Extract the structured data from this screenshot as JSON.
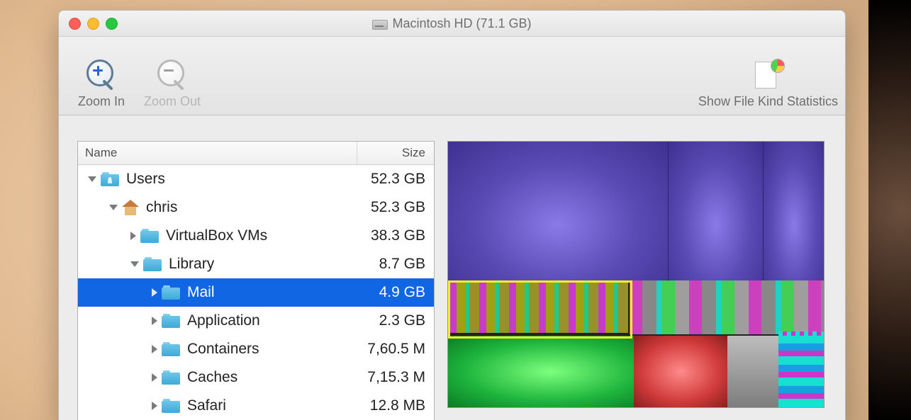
{
  "window": {
    "title": "Macintosh HD (71.1 GB)"
  },
  "toolbar": {
    "zoom_in": "Zoom In",
    "zoom_out": "Zoom Out",
    "stats": "Show File Kind Statistics"
  },
  "tree": {
    "header_name": "Name",
    "header_size": "Size",
    "rows": [
      {
        "indent": 0,
        "state": "open",
        "icon": "folder-user",
        "name": "Users",
        "size": "52.3 GB",
        "selected": false
      },
      {
        "indent": 1,
        "state": "open",
        "icon": "home",
        "name": "chris",
        "size": "52.3 GB",
        "selected": false
      },
      {
        "indent": 2,
        "state": "closed",
        "icon": "folder",
        "name": "VirtualBox VMs",
        "size": "38.3 GB",
        "selected": false
      },
      {
        "indent": 2,
        "state": "open",
        "icon": "folder-lib",
        "name": "Library",
        "size": "8.7 GB",
        "selected": false
      },
      {
        "indent": 3,
        "state": "closed",
        "icon": "folder",
        "name": "Mail",
        "size": "4.9 GB",
        "selected": true
      },
      {
        "indent": 3,
        "state": "closed",
        "icon": "folder",
        "name": "Application",
        "size": "2.3 GB",
        "selected": false
      },
      {
        "indent": 3,
        "state": "closed",
        "icon": "folder",
        "name": "Containers",
        "size": "7,60.5 M",
        "selected": false
      },
      {
        "indent": 3,
        "state": "closed",
        "icon": "folder",
        "name": "Caches",
        "size": "7,15.3 M",
        "selected": false
      },
      {
        "indent": 3,
        "state": "closed",
        "icon": "folder",
        "name": "Safari",
        "size": "12.8 MB",
        "selected": false
      }
    ]
  }
}
